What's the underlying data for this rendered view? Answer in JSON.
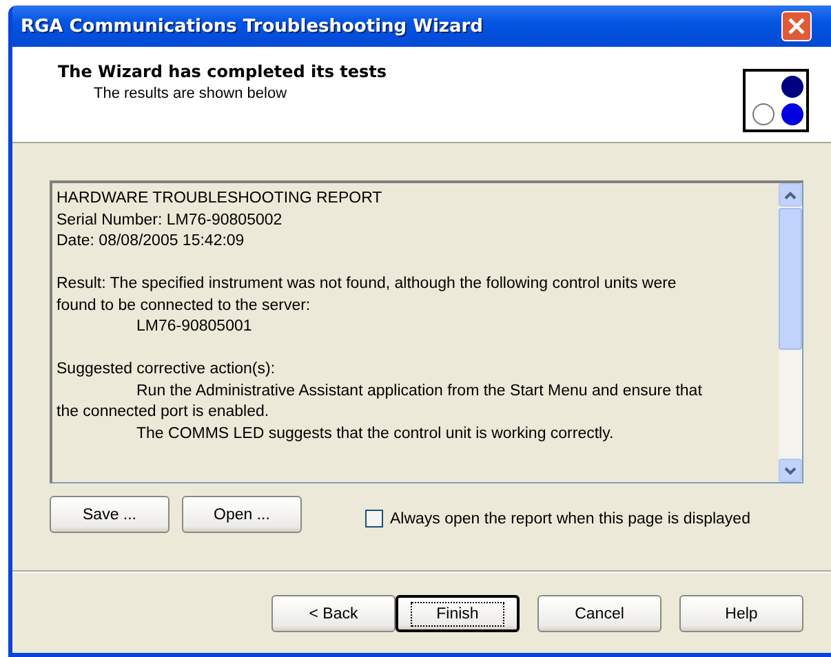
{
  "window": {
    "title": "RGA Communications Troubleshooting Wizard"
  },
  "header": {
    "title": "The Wizard has completed its tests",
    "subtitle": "The results are shown below"
  },
  "report": {
    "lines": [
      {
        "text": "HARDWARE TROUBLESHOOTING REPORT",
        "indented": false,
        "space_before": false
      },
      {
        "text": "Serial Number: LM76-90805002",
        "indented": false,
        "space_before": false
      },
      {
        "text": "Date: 08/08/2005 15:42:09",
        "indented": false,
        "space_before": false
      },
      {
        "text": "Result: The specified instrument was not found, although the following control units were found to be connected to the server:",
        "indented": false,
        "space_before": true
      },
      {
        "text": "LM76-90805001",
        "indented": true,
        "space_before": false
      },
      {
        "text": "Suggested corrective action(s):",
        "indented": false,
        "space_before": true
      },
      {
        "text": "Run the Administrative Assistant application from the Start Menu and ensure that the connected port is enabled.",
        "indented": true,
        "space_before": false
      },
      {
        "text": "The COMMS LED suggests that the control unit is working correctly.",
        "indented": true,
        "space_before": false
      }
    ]
  },
  "file_buttons": [
    "Save ...",
    "Open ..."
  ],
  "always_open": {
    "label": "Always open the report when this page is displayed",
    "checked": false
  },
  "nav_buttons": [
    {
      "label": "< Back",
      "default": false
    },
    {
      "label": "Finish",
      "default": true
    },
    {
      "label": "Cancel",
      "default": false
    },
    {
      "label": "Help",
      "default": false
    }
  ]
}
